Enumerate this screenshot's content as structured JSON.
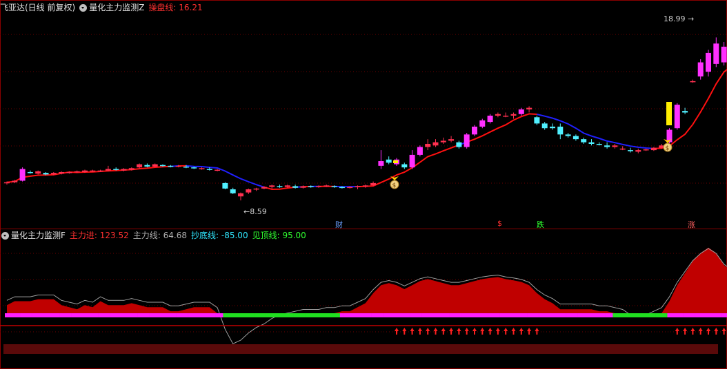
{
  "main_header": {
    "stock_name": "飞亚达(日线 前复权)",
    "indicator_name": "量化主力监测Z",
    "line_label": "操盘线:",
    "line_value": "16.21"
  },
  "sub_header": {
    "indicator_name": "量化主力监测F",
    "items": [
      {
        "label": "主力进:",
        "value": "123.52",
        "color": "#ff3030"
      },
      {
        "label": "主力线:",
        "value": "64.68",
        "color": "#b0b0b0"
      },
      {
        "label": "抄底线:",
        "value": "-85.00",
        "color": "#30e8ff"
      },
      {
        "label": "见顶线:",
        "value": "95.00",
        "color": "#30ff30"
      }
    ]
  },
  "price_labels": {
    "high": "18.99",
    "low": "8.59"
  },
  "event_markers": [
    {
      "text": "财",
      "color": "#6aa0ff"
    },
    {
      "text": "$",
      "color": "#ff3030"
    },
    {
      "text": "跌",
      "color": "#30ff30"
    },
    {
      "text": "涨",
      "color": "#ff6060"
    }
  ],
  "colors": {
    "up": "#ff3050",
    "up_strong": "#ff30ff",
    "down": "#50f0ff",
    "line_red": "#ff1010",
    "line_blue": "#2020ff",
    "grid": "#700000",
    "dot_magenta": "#ff20ff",
    "dot_green": "#20e020",
    "area_red": "#c00000"
  },
  "chart_data": {
    "type": "candlestick",
    "price_axis_range": [
      7.5,
      20.5
    ],
    "candles": [
      [
        9.7,
        9.8,
        9.6,
        9.75
      ],
      [
        9.75,
        9.9,
        9.7,
        9.85
      ],
      [
        9.85,
        10.7,
        9.8,
        10.6
      ],
      [
        10.4,
        10.5,
        10.3,
        10.35
      ],
      [
        10.3,
        10.5,
        10.25,
        10.45
      ],
      [
        10.35,
        10.4,
        10.2,
        10.25
      ],
      [
        10.25,
        10.4,
        10.2,
        10.35
      ],
      [
        10.3,
        10.45,
        10.25,
        10.4
      ],
      [
        10.35,
        10.45,
        10.3,
        10.4
      ],
      [
        10.4,
        10.5,
        10.35,
        10.45
      ],
      [
        10.4,
        10.55,
        10.35,
        10.5
      ],
      [
        10.45,
        10.55,
        10.4,
        10.5
      ],
      [
        10.45,
        10.55,
        10.4,
        10.5
      ],
      [
        10.5,
        10.8,
        10.45,
        10.6
      ],
      [
        10.6,
        10.7,
        10.5,
        10.55
      ],
      [
        10.5,
        10.65,
        10.45,
        10.6
      ],
      [
        10.55,
        10.7,
        10.5,
        10.65
      ],
      [
        10.7,
        10.95,
        10.65,
        10.9
      ],
      [
        10.85,
        10.95,
        10.7,
        10.75
      ],
      [
        10.75,
        10.95,
        10.7,
        10.9
      ],
      [
        10.85,
        10.9,
        10.75,
        10.8
      ],
      [
        10.8,
        10.85,
        10.7,
        10.75
      ],
      [
        10.75,
        10.85,
        10.7,
        10.8
      ],
      [
        10.75,
        10.85,
        10.65,
        10.7
      ],
      [
        10.7,
        10.75,
        10.6,
        10.65
      ],
      [
        10.6,
        10.7,
        10.55,
        10.65
      ],
      [
        10.6,
        10.7,
        10.5,
        10.55
      ],
      [
        10.5,
        10.6,
        10.45,
        10.55
      ],
      [
        9.7,
        9.75,
        9.3,
        9.35
      ],
      [
        9.3,
        9.4,
        9.0,
        9.05
      ],
      [
        8.85,
        9.1,
        8.59,
        9.05
      ],
      [
        9.1,
        9.35,
        9.0,
        9.3
      ],
      [
        9.3,
        9.4,
        9.2,
        9.35
      ],
      [
        9.35,
        9.5,
        9.3,
        9.45
      ],
      [
        9.45,
        9.6,
        9.35,
        9.55
      ],
      [
        9.5,
        9.6,
        9.4,
        9.45
      ],
      [
        9.45,
        9.6,
        9.4,
        9.55
      ],
      [
        9.5,
        9.6,
        9.35,
        9.4
      ],
      [
        9.4,
        9.55,
        9.35,
        9.5
      ],
      [
        9.5,
        9.55,
        9.4,
        9.45
      ],
      [
        9.45,
        9.55,
        9.4,
        9.5
      ],
      [
        9.5,
        9.6,
        9.45,
        9.55
      ],
      [
        9.5,
        9.55,
        9.4,
        9.45
      ],
      [
        9.45,
        9.5,
        9.35,
        9.4
      ],
      [
        9.4,
        9.5,
        9.35,
        9.45
      ],
      [
        9.45,
        9.55,
        9.3,
        9.5
      ],
      [
        9.5,
        9.6,
        9.4,
        9.55
      ],
      [
        9.55,
        9.8,
        9.5,
        9.7
      ],
      [
        10.8,
        11.8,
        10.6,
        11.1
      ],
      [
        11.2,
        11.4,
        10.9,
        11.0
      ],
      [
        10.9,
        11.3,
        10.8,
        11.2
      ],
      [
        10.9,
        11.0,
        10.6,
        10.7
      ],
      [
        10.7,
        11.8,
        10.6,
        11.5
      ],
      [
        11.5,
        12.1,
        11.4,
        12.0
      ],
      [
        12.0,
        12.5,
        11.8,
        12.2
      ],
      [
        12.1,
        12.5,
        12.0,
        12.3
      ],
      [
        12.3,
        12.6,
        12.2,
        12.4
      ],
      [
        12.4,
        12.7,
        12.3,
        12.5
      ],
      [
        12.3,
        12.4,
        11.9,
        12.0
      ],
      [
        12.0,
        12.9,
        11.9,
        12.8
      ],
      [
        12.8,
        13.4,
        12.7,
        13.3
      ],
      [
        13.3,
        13.8,
        13.2,
        13.7
      ],
      [
        13.6,
        14.1,
        13.5,
        14.0
      ],
      [
        14.0,
        14.2,
        13.9,
        14.1
      ],
      [
        14.0,
        14.2,
        13.9,
        14.0
      ],
      [
        14.0,
        14.2,
        13.8,
        14.1
      ],
      [
        14.1,
        14.5,
        14.0,
        14.4
      ],
      [
        14.4,
        14.6,
        14.2,
        14.5
      ],
      [
        13.9,
        14.0,
        13.4,
        13.5
      ],
      [
        13.5,
        13.6,
        13.1,
        13.2
      ],
      [
        13.3,
        13.5,
        13.1,
        13.2
      ],
      [
        13.3,
        13.5,
        12.5,
        12.8
      ],
      [
        12.8,
        12.9,
        12.6,
        12.7
      ],
      [
        12.7,
        12.8,
        12.4,
        12.5
      ],
      [
        12.5,
        12.6,
        12.2,
        12.3
      ],
      [
        12.3,
        12.5,
        12.1,
        12.2
      ],
      [
        12.2,
        12.3,
        12.1,
        12.15
      ],
      [
        12.1,
        12.3,
        11.9,
        12.0
      ],
      [
        12.0,
        12.2,
        11.9,
        12.1
      ],
      [
        11.9,
        12.05,
        11.8,
        11.9
      ],
      [
        11.8,
        11.95,
        11.65,
        11.75
      ],
      [
        11.7,
        11.9,
        11.6,
        11.8
      ],
      [
        11.8,
        11.9,
        11.75,
        11.85
      ],
      [
        11.8,
        12.0,
        11.75,
        11.95
      ],
      [
        11.95,
        12.2,
        11.9,
        12.1
      ],
      [
        12.3,
        13.2,
        12.2,
        13.1
      ],
      [
        13.2,
        14.8,
        13.1,
        14.7
      ],
      [
        14.3,
        14.5,
        14.1,
        14.2
      ],
      [
        16.2,
        16.3,
        16.1,
        16.2
      ],
      [
        16.5,
        17.6,
        16.3,
        17.4
      ],
      [
        16.8,
        18.2,
        16.5,
        18.0
      ],
      [
        17.3,
        18.99,
        17.1,
        18.6
      ],
      [
        17.4,
        18.7,
        17.2,
        18.4
      ],
      [
        17.7,
        17.9,
        16.8,
        17.5
      ]
    ],
    "sub_axis_range": [
      -160,
      140
    ],
    "sub_values": [
      [
        -20,
        -30
      ],
      [
        -10,
        -30
      ],
      [
        -10,
        -28
      ],
      [
        -10,
        -30
      ],
      [
        -5,
        -31
      ],
      [
        -5,
        -31
      ],
      [
        -5,
        -31
      ],
      [
        -20,
        -32
      ],
      [
        -25,
        -32
      ],
      [
        -30,
        -33
      ],
      [
        -20,
        -33
      ],
      [
        -25,
        -33
      ],
      [
        -10,
        -33
      ],
      [
        -20,
        -33
      ],
      [
        -20,
        -33
      ],
      [
        -20,
        -34
      ],
      [
        -15,
        -34
      ],
      [
        -20,
        -34
      ],
      [
        -25,
        -35
      ],
      [
        -25,
        -35
      ],
      [
        -25,
        -35
      ],
      [
        -35,
        -35
      ],
      [
        -35,
        -35
      ],
      [
        -30,
        -35
      ],
      [
        -25,
        -35
      ],
      [
        -25,
        -35
      ],
      [
        -25,
        -35
      ],
      [
        -40,
        -35
      ],
      [
        -100,
        -45
      ],
      [
        -140,
        -70
      ],
      [
        -130,
        -90
      ],
      [
        -110,
        -95
      ],
      [
        -95,
        -85
      ],
      [
        -85,
        -75
      ],
      [
        -70,
        -65
      ],
      [
        -60,
        -55
      ],
      [
        -55,
        -48
      ],
      [
        -50,
        -45
      ],
      [
        -45,
        -42
      ],
      [
        -45,
        -40
      ],
      [
        -45,
        -40
      ],
      [
        -40,
        -40
      ],
      [
        -40,
        -38
      ],
      [
        -35,
        -37
      ],
      [
        -35,
        -37
      ],
      [
        -25,
        -35
      ],
      [
        -15,
        -30
      ],
      [
        10,
        -20
      ],
      [
        30,
        -5
      ],
      [
        35,
        5
      ],
      [
        30,
        15
      ],
      [
        20,
        18
      ],
      [
        30,
        22
      ],
      [
        40,
        28
      ],
      [
        45,
        35
      ],
      [
        40,
        38
      ],
      [
        35,
        40
      ],
      [
        30,
        40
      ],
      [
        30,
        38
      ],
      [
        35,
        38
      ],
      [
        40,
        39
      ],
      [
        45,
        42
      ],
      [
        48,
        46
      ],
      [
        50,
        48
      ],
      [
        45,
        49
      ],
      [
        42,
        48
      ],
      [
        38,
        46
      ],
      [
        30,
        42
      ],
      [
        10,
        35
      ],
      [
        -5,
        25
      ],
      [
        -15,
        10
      ],
      [
        -30,
        -5
      ],
      [
        -30,
        -12
      ],
      [
        -30,
        -16
      ],
      [
        -30,
        -20
      ],
      [
        -30,
        -22
      ],
      [
        -35,
        -25
      ],
      [
        -35,
        -28
      ],
      [
        -40,
        -31
      ],
      [
        -45,
        -35
      ],
      [
        -60,
        -45
      ],
      [
        -65,
        -52
      ],
      [
        -60,
        -56
      ],
      [
        -50,
        -57
      ],
      [
        -40,
        -55
      ],
      [
        -10,
        -45
      ],
      [
        30,
        -25
      ],
      [
        60,
        0
      ],
      [
        90,
        25
      ],
      [
        110,
        45
      ],
      [
        123.52,
        60
      ],
      [
        110,
        60
      ],
      [
        80,
        64.68
      ],
      [
        64.68,
        64.68
      ]
    ],
    "sub_dots": "magenta when 主力线 above -40 else green"
  }
}
